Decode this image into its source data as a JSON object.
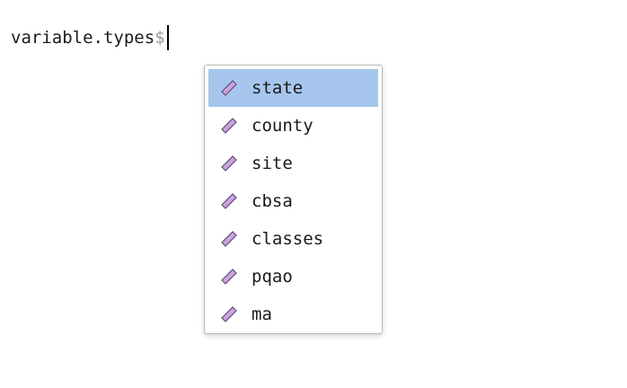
{
  "editor": {
    "text": "variable.types",
    "trigger": "$"
  },
  "autocomplete": {
    "selected_index": 0,
    "icon": "member-variable-icon",
    "icon_fill": "#c7a6da",
    "icon_stroke": "#6a4a80",
    "items": [
      {
        "label": "state"
      },
      {
        "label": "county"
      },
      {
        "label": "site"
      },
      {
        "label": "cbsa"
      },
      {
        "label": "classes"
      },
      {
        "label": "pqao"
      },
      {
        "label": "ma"
      }
    ]
  }
}
